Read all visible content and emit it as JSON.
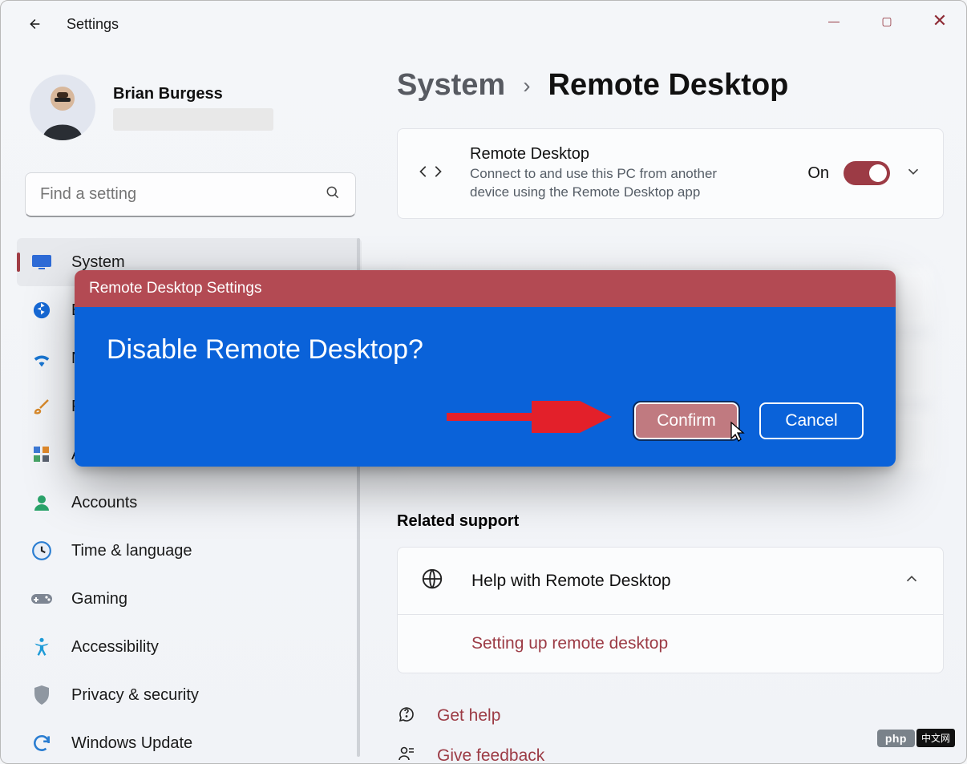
{
  "app": {
    "title": "Settings"
  },
  "window_controls": {
    "min": "—",
    "max": "▢",
    "close": "✕"
  },
  "user": {
    "name": "Brian Burgess"
  },
  "search": {
    "placeholder": "Find a setting"
  },
  "nav": {
    "items": [
      {
        "icon": "monitor-icon",
        "label": "System",
        "fg": "#2e6bd6",
        "selected": true
      },
      {
        "icon": "bluetooth-icon",
        "label": "Bluetooth & devices",
        "fg": "#1669d6",
        "selected": false
      },
      {
        "icon": "wifi-icon",
        "label": "Network & internet",
        "fg": "#1976d2",
        "selected": false
      },
      {
        "icon": "brush-icon",
        "label": "Personalization",
        "fg": "#d98a2b",
        "selected": false
      },
      {
        "icon": "apps-icon",
        "label": "Apps",
        "fg": "#5a6270",
        "selected": false
      },
      {
        "icon": "person-icon",
        "label": "Accounts",
        "fg": "#2aa36a",
        "selected": false
      },
      {
        "icon": "clock-icon",
        "label": "Time & language",
        "fg": "#2a7dd1",
        "selected": false
      },
      {
        "icon": "gamepad-icon",
        "label": "Gaming",
        "fg": "#7d8592",
        "selected": false
      },
      {
        "icon": "accessibility-icon",
        "label": "Accessibility",
        "fg": "#1e9bd7",
        "selected": false
      },
      {
        "icon": "shield-icon",
        "label": "Privacy & security",
        "fg": "#8f97a1",
        "selected": false
      },
      {
        "icon": "sync-icon",
        "label": "Windows Update",
        "fg": "#2a7dd1",
        "selected": false
      }
    ]
  },
  "breadcrumb": {
    "parent": "System",
    "sep": "›",
    "page": "Remote Desktop"
  },
  "rd_card": {
    "title": "Remote Desktop",
    "sub": "Connect to and use this PC from another device using the Remote Desktop app",
    "state": "On"
  },
  "related": {
    "heading": "Related support"
  },
  "help_card": {
    "row1": "Help with Remote Desktop",
    "row2": "Setting up remote desktop"
  },
  "links": {
    "help": "Get help",
    "feedback": "Give feedback"
  },
  "dialog": {
    "title": "Remote Desktop Settings",
    "question": "Disable Remote Desktop?",
    "confirm": "Confirm",
    "cancel": "Cancel"
  },
  "badge": {
    "php": "php",
    "cn": "中文网"
  }
}
